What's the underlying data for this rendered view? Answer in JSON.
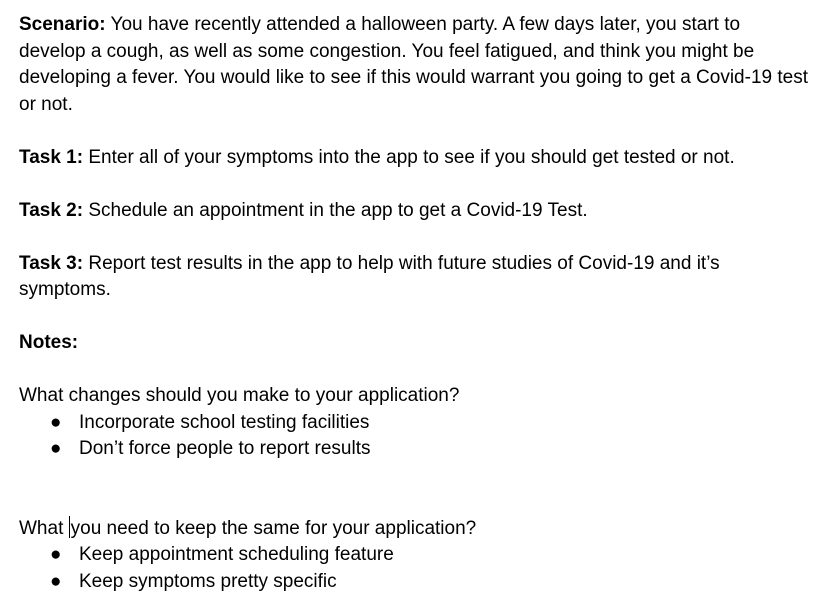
{
  "scenario": {
    "label": "Scenario:",
    "text": " You have recently attended a halloween party. A few days later, you start to develop a cough, as well as some congestion. You feel fatigued, and think you might be developing a fever. You would like to see if this would warrant you going to get a Covid-19 test or not."
  },
  "tasks": [
    {
      "label": "Task 1:",
      "text": " Enter all of your symptoms into the app to see if you should get tested or not."
    },
    {
      "label": "Task 2:",
      "text": " Schedule an appointment in the app to get a Covid-19 Test."
    },
    {
      "label": "Task 3:",
      "text": " Report test results in the app to help with future studies of Covid-19 and it’s symptoms."
    }
  ],
  "notes": {
    "label": "Notes:",
    "changes": {
      "question": "What changes should you make to your application?",
      "items": [
        "Incorporate school testing facilities",
        "Don’t force people to report results"
      ]
    },
    "keep": {
      "question_before_cursor": "What ",
      "question_after_cursor": "you need to keep the same for your application?",
      "items": [
        "Keep appointment scheduling feature",
        "Keep symptoms pretty specific"
      ]
    }
  },
  "bullet_glyph": "●"
}
